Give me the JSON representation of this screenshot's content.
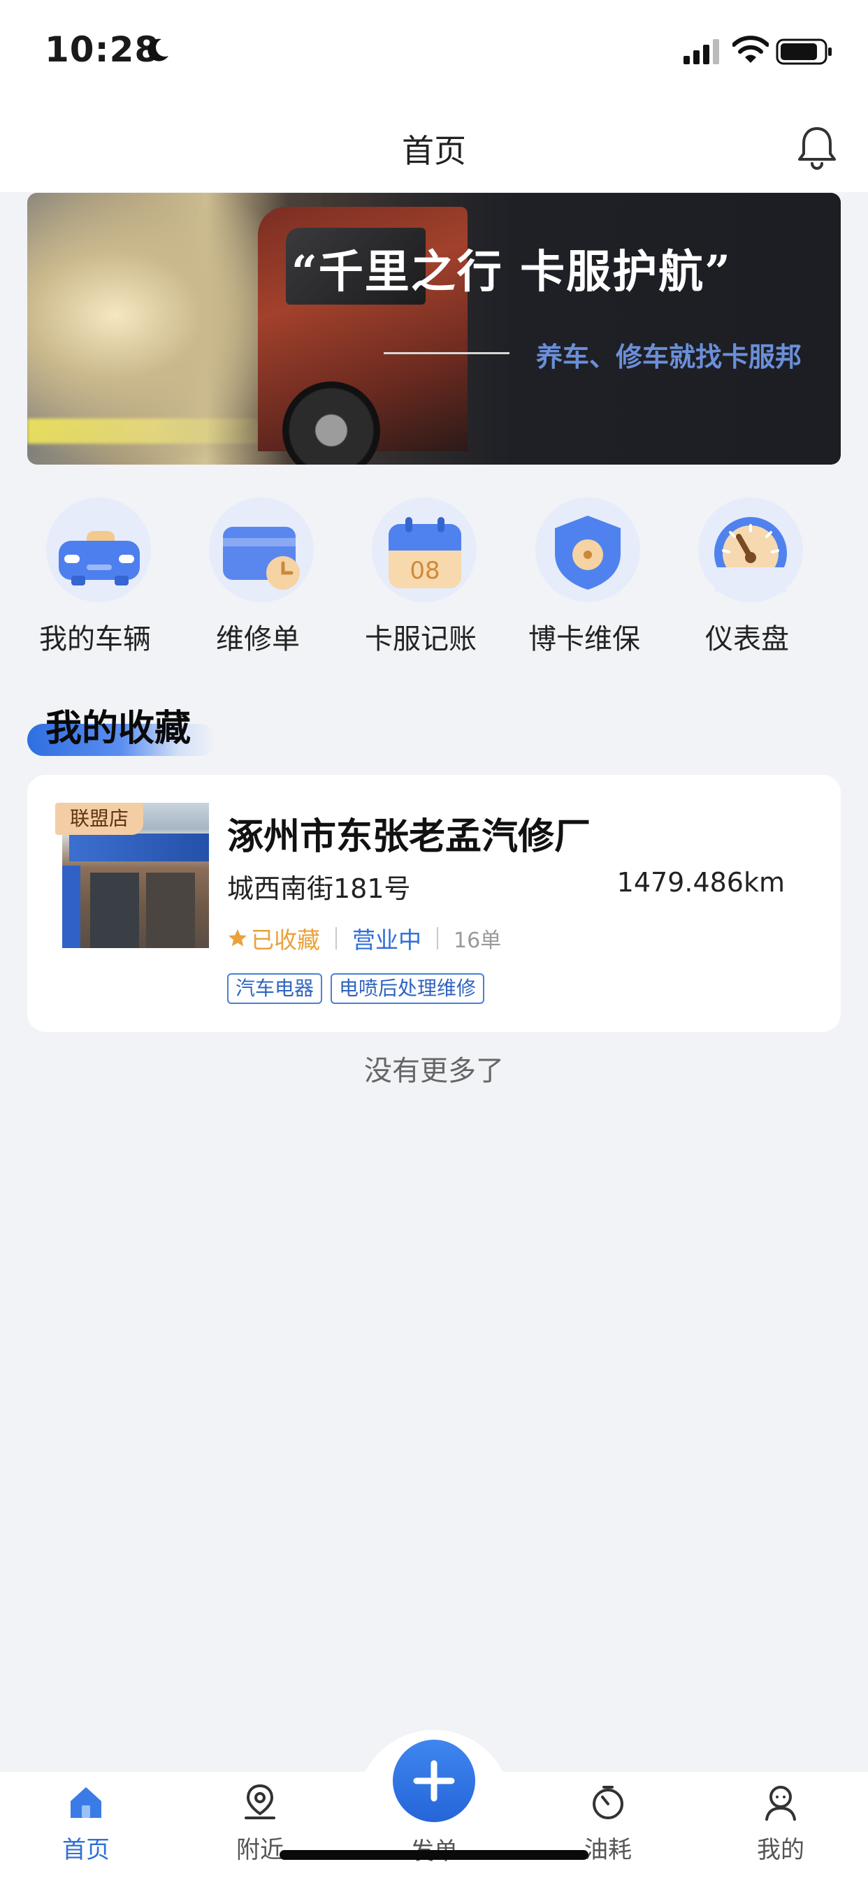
{
  "status_bar": {
    "time": "10:28"
  },
  "header": {
    "title": "首页"
  },
  "banner": {
    "headline": "“千里之行 卡服护航”",
    "subline": "养车、修车就找卡服邦"
  },
  "quick_menu": [
    {
      "label": "我的车辆",
      "icon": "car-icon"
    },
    {
      "label": "维修单",
      "icon": "wallet-clock-icon"
    },
    {
      "label": "卡服记账",
      "icon": "calendar-icon",
      "badge": "08"
    },
    {
      "label": "博卡维保",
      "icon": "shield-icon"
    },
    {
      "label": "仪表盘",
      "icon": "gauge-icon"
    }
  ],
  "favorites": {
    "section_title": "我的收藏",
    "items": [
      {
        "badge": "联盟店",
        "name": "涿州市东张老孟汽修厂",
        "address": "城西南街181号",
        "distance": "1479.486km",
        "favorite_label": "已收藏",
        "status": "营业中",
        "orders": "16单",
        "tags": [
          "汽车电器",
          "电喷后处理维修"
        ]
      }
    ],
    "end_text": "没有更多了"
  },
  "tab_bar": {
    "items": [
      {
        "label": "首页",
        "icon": "home-icon",
        "active": true
      },
      {
        "label": "附近",
        "icon": "location-pin-icon",
        "active": false
      },
      {
        "label": "发单",
        "icon": "plus-icon",
        "active": false
      },
      {
        "label": "油耗",
        "icon": "timer-icon",
        "active": false
      },
      {
        "label": "我的",
        "icon": "user-icon",
        "active": false
      }
    ]
  },
  "colors": {
    "accent": "#2e6fd9",
    "favorite": "#e9a23b",
    "background": "#f1f3f6"
  }
}
